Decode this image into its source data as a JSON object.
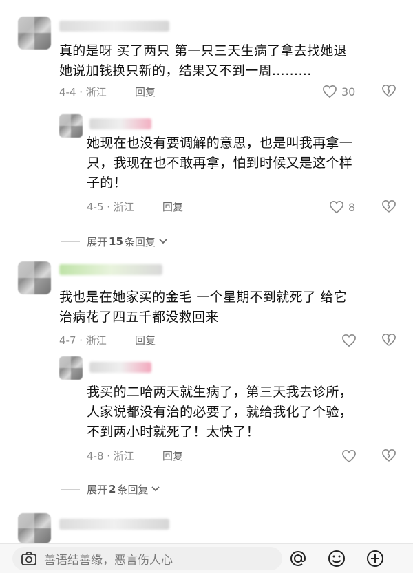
{
  "comments": [
    {
      "text_lines": [
        "真的是呀 买了两只 第一只三天生病了拿去找她退",
        "她说加钱换只新的，结果又不到一周………"
      ],
      "date": "4-4 · 浙江",
      "reply_label": "回复",
      "like_count": "30"
    },
    {
      "text_lines": [
        "她现在也没有要调解的意思，也是叫我再拿一",
        "只，我现在也不敢再拿，怕到时候又是这个样",
        "子的！"
      ],
      "date": "4-5 · 浙江",
      "reply_label": "回复",
      "like_count": "8"
    },
    {
      "expand_prefix": "展开",
      "expand_count": "15",
      "expand_suffix": "条回复"
    },
    {
      "text_lines": [
        "我也是在她家买的金毛  一个星期不到就死了  给它",
        "治病花了四五千都没救回来"
      ],
      "date": "4-7 · 浙江",
      "reply_label": "回复",
      "like_count": ""
    },
    {
      "text_lines": [
        "我买的二哈两天就生病了，第三天我去诊所，",
        "人家说都没有治的必要了，就给我化了个验，",
        "不到两小时就死了！太快了！"
      ],
      "date": "4-8 · 浙江",
      "reply_label": "回复",
      "like_count": ""
    },
    {
      "expand_prefix": "展开",
      "expand_count": "2",
      "expand_suffix": "条回复"
    }
  ],
  "input": {
    "placeholder": "善语结善缘，恶言伤人心"
  },
  "icons": {
    "camera": "camera-icon",
    "at": "at-icon",
    "emoji": "emoji-icon",
    "add": "add-icon",
    "like": "heart-outline-icon",
    "dislike": "broken-heart-icon"
  },
  "colors": {
    "text": "#111111",
    "meta": "#8a8a8a",
    "input_bg": "#efefef"
  }
}
